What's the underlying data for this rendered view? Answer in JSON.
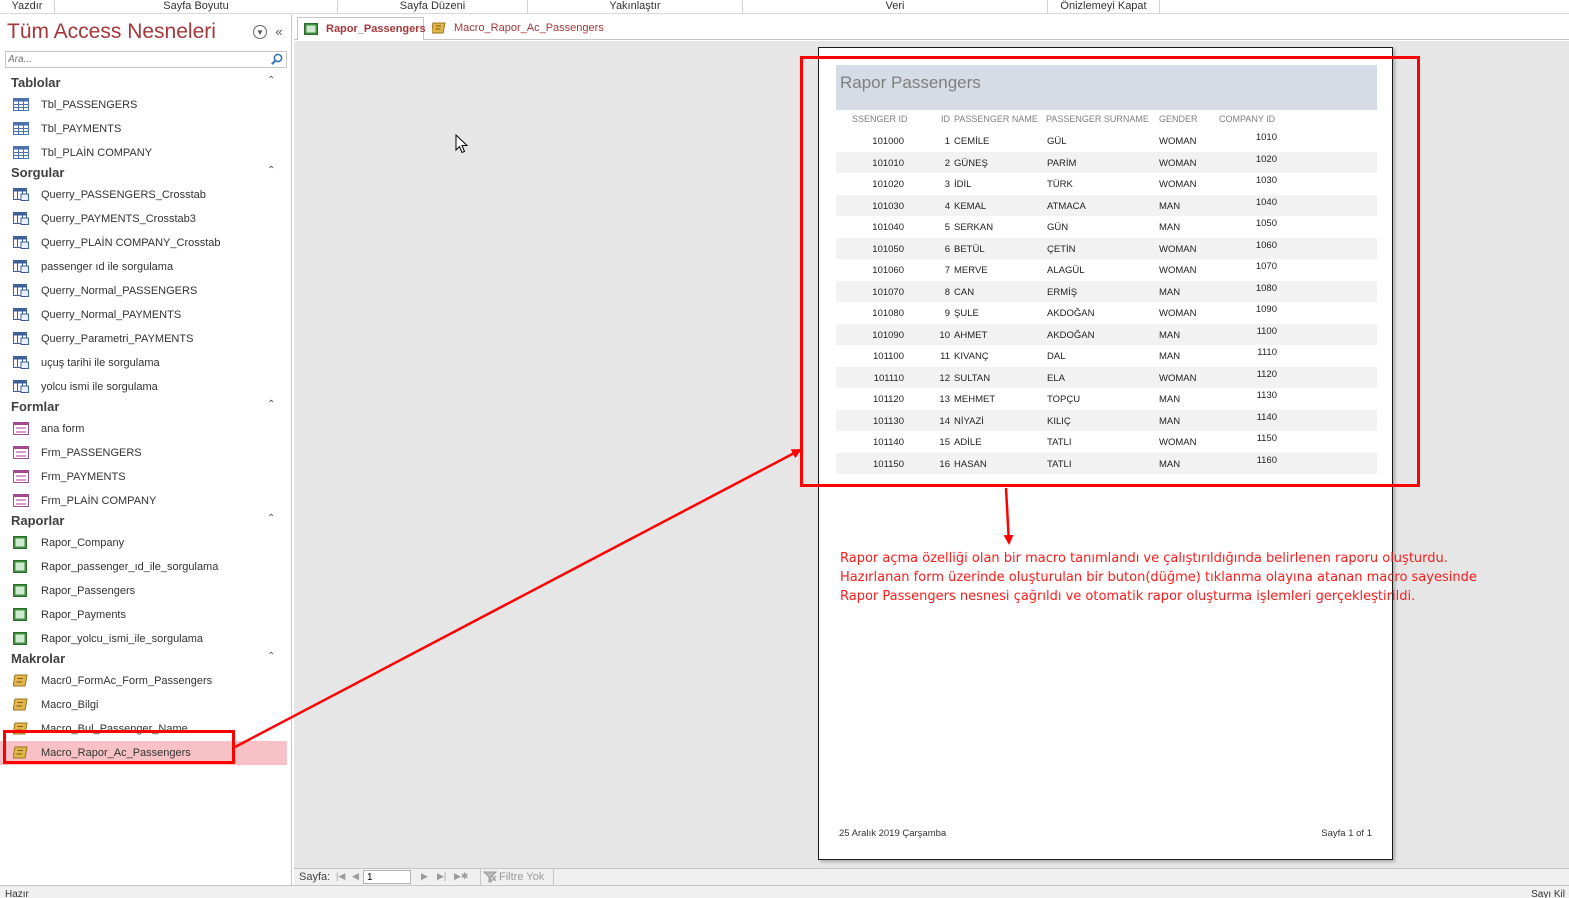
{
  "ribbon": {
    "groups": [
      "Yazdır",
      "Sayfa Boyutu",
      "Sayfa Düzeni",
      "Yakınlaştır",
      "Veri",
      "Önizlemeyi Kapat"
    ]
  },
  "nav": {
    "title": "Tüm Access Nesneleri",
    "search_placeholder": "Ara...",
    "groups": [
      {
        "title": "Tablolar",
        "icon": "table-icon",
        "items": [
          "Tbl_PASSENGERS",
          "Tbl_PAYMENTS",
          "Tbl_PLAİN COMPANY"
        ]
      },
      {
        "title": "Sorgular",
        "icon": "query-icon",
        "items": [
          "Querry_PASSENGERS_Crosstab",
          "Querry_PAYMENTS_Crosstab3",
          "Querry_PLAİN COMPANY_Crosstab",
          "passenger ıd ile sorgulama",
          "Querry_Normal_PASSENGERS",
          "Querry_Normal_PAYMENTS",
          "Querry_Parametri_PAYMENTS",
          "uçuş tarihi ile sorgulama",
          "yolcu ismi ile sorgulama"
        ]
      },
      {
        "title": "Formlar",
        "icon": "form-icon",
        "items": [
          "ana form",
          "Frm_PASSENGERS",
          "Frm_PAYMENTS",
          "Frm_PLAİN COMPANY"
        ]
      },
      {
        "title": "Raporlar",
        "icon": "report-icon",
        "items": [
          "Rapor_Company",
          "Rapor_passenger_ıd_ile_sorgulama",
          "Rapor_Passengers",
          "Rapor_Payments",
          "Rapor_yolcu_ismi_ile_sorgulama"
        ]
      },
      {
        "title": "Makrolar",
        "icon": "macro-icon",
        "items": [
          "Macr0_FormAc_Form_Passengers",
          "Macro_Bilgi",
          "Macro_Bul_Passenger_Name",
          "Macro_Rapor_Ac_Passengers"
        ]
      }
    ],
    "selected_item": "Macro_Rapor_Ac_Passengers"
  },
  "tabs": [
    {
      "label": "Rapor_Passengers",
      "icon": "report-icon",
      "active": true
    },
    {
      "label": "Macro_Rapor_Ac_Passengers",
      "icon": "macro-icon",
      "active": false
    }
  ],
  "report": {
    "title": "Rapor Passengers",
    "columns": [
      "SSENGER ID",
      "ID",
      "PASSENGER NAME",
      "PASSENGER SURNAME",
      "GENDER",
      "COMPANY ID"
    ],
    "rows": [
      [
        "101000",
        "1",
        "CEMİLE",
        "GÜL",
        "WOMAN",
        "1010"
      ],
      [
        "101010",
        "2",
        "GÜNEŞ",
        "PARİM",
        "WOMAN",
        "1020"
      ],
      [
        "101020",
        "3",
        "İDİL",
        "TÜRK",
        "WOMAN",
        "1030"
      ],
      [
        "101030",
        "4",
        "KEMAL",
        "ATMACA",
        "MAN",
        "1040"
      ],
      [
        "101040",
        "5",
        "SERKAN",
        "GÜN",
        "MAN",
        "1050"
      ],
      [
        "101050",
        "6",
        "BETÜL",
        "ÇETİN",
        "WOMAN",
        "1060"
      ],
      [
        "101060",
        "7",
        "MERVE",
        "ALAGÜL",
        "WOMAN",
        "1070"
      ],
      [
        "101070",
        "8",
        "CAN",
        "ERMİŞ",
        "MAN",
        "1080"
      ],
      [
        "101080",
        "9",
        "ŞULE",
        "AKDOĞAN",
        "WOMAN",
        "1090"
      ],
      [
        "101090",
        "10",
        "AHMET",
        "AKDOĞAN",
        "MAN",
        "1100"
      ],
      [
        "101100",
        "11",
        "KIVANÇ",
        "DAL",
        "MAN",
        "1110"
      ],
      [
        "101110",
        "12",
        "SULTAN",
        "ELA",
        "WOMAN",
        "1120"
      ],
      [
        "101120",
        "13",
        "MEHMET",
        "TOPÇU",
        "MAN",
        "1130"
      ],
      [
        "101130",
        "14",
        "NİYAZİ",
        "KILIÇ",
        "MAN",
        "1140"
      ],
      [
        "101140",
        "15",
        "ADİLE",
        "TATLI",
        "WOMAN",
        "1150"
      ],
      [
        "101150",
        "16",
        "HASAN",
        "TATLI",
        "MAN",
        "1160"
      ]
    ],
    "footer_date": "25 Aralık 2019 Çarşamba",
    "footer_page": "Sayfa 1 of 1"
  },
  "annotation": {
    "lines": [
      "Rapor açma özelliği olan bir macro tanımlandı ve çalıştırıldığında belirlenen raporu oluşturdu.",
      "Hazırlanan form üzerinde oluşturulan bir buton(düğme) tıklanma olayına atanan macro sayesinde",
      "Rapor Passengers nesnesi çağrıldı ve otomatik rapor oluşturma işlemleri gerçekleştirildi."
    ]
  },
  "record_nav": {
    "label": "Sayfa:",
    "page_value": "1",
    "filter_label": "Filtre Yok"
  },
  "status": {
    "left": "Hazır",
    "right": "Sayı Kil"
  },
  "colors": {
    "accent": "#a4373a",
    "selection": "#f8c1c5",
    "annotation": "#ff1a1a",
    "title_band": "#d6dce5"
  }
}
